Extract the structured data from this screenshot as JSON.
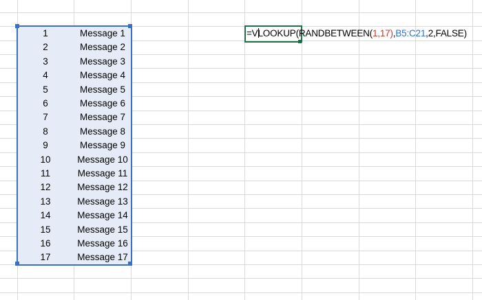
{
  "sheet": {
    "table": {
      "rows": [
        {
          "num": "1",
          "message": "Message 1"
        },
        {
          "num": "2",
          "message": "Message 2"
        },
        {
          "num": "3",
          "message": "Message 3"
        },
        {
          "num": "4",
          "message": "Message 4"
        },
        {
          "num": "5",
          "message": "Message 5"
        },
        {
          "num": "6",
          "message": "Message 6"
        },
        {
          "num": "7",
          "message": "Message 7"
        },
        {
          "num": "8",
          "message": "Message 8"
        },
        {
          "num": "9",
          "message": "Message 9"
        },
        {
          "num": "10",
          "message": "Message 10"
        },
        {
          "num": "11",
          "message": "Message 11"
        },
        {
          "num": "12",
          "message": "Message 12"
        },
        {
          "num": "13",
          "message": "Message 13"
        },
        {
          "num": "14",
          "message": "Message 14"
        },
        {
          "num": "15",
          "message": "Message 15"
        },
        {
          "num": "16",
          "message": "Message 16"
        },
        {
          "num": "17",
          "message": "Message 17"
        }
      ]
    },
    "formula": {
      "part1": "=V",
      "part2": "LOOKUP(",
      "part3": "RANDBETWEEN(",
      "part4": "1,17",
      "part5": ")",
      "part6": ",",
      "part7": "B5:C21",
      "part8": ",2,FALSE)"
    },
    "colors": {
      "selection_border": "#3a6fc6",
      "selection_fill": "#e6ecf7",
      "editing_border": "#1e7145",
      "formula_red": "#c0392b",
      "formula_blue": "#2f6fd0",
      "gridline": "#d9d9d9"
    }
  }
}
